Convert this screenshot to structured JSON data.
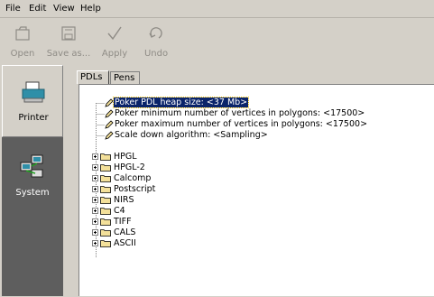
{
  "menu": {
    "items": [
      "File",
      "Edit",
      "View",
      "Help"
    ]
  },
  "toolbar": {
    "open_label": "Open",
    "save_label": "Save as...",
    "apply_label": "Apply",
    "undo_label": "Undo"
  },
  "nav": {
    "printer_label": "Printer",
    "system_label": "System"
  },
  "tabs": {
    "pdls_label": "PDLs",
    "pens_label": "Pens"
  },
  "tree": {
    "params": [
      "Poker PDL heap size: <37 Mb>",
      "Poker minimum number of vertices in polygons: <17500>",
      "Poker maximum number of vertices in polygons: <17500>",
      "Scale down algorithm: <Sampling>"
    ],
    "folders": [
      "HPGL",
      "HPGL-2",
      "Calcomp",
      "Postscript",
      "NIRS",
      "C4",
      "TIFF",
      "CALS",
      "ASCII"
    ]
  },
  "colors": {
    "selection": "#0a246a",
    "nav_background": "#5e5e5e",
    "window_background": "#d4d0c8",
    "folder_icon": "#f3e09a"
  }
}
